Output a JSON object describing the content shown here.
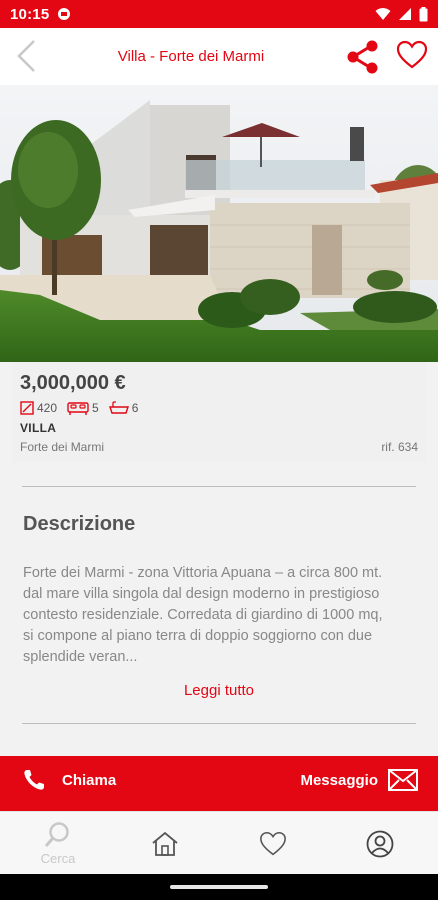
{
  "status_bar": {
    "time": "10:15"
  },
  "header": {
    "title": "Villa - Forte dei Marmi"
  },
  "listing": {
    "price": "3,000,000 €",
    "features": {
      "area": "420",
      "bedrooms": "5",
      "bathrooms": "6"
    },
    "type": "VILLA",
    "location": "Forte dei Marmi",
    "reference": "rif. 634"
  },
  "description": {
    "title": "Descrizione",
    "text": "Forte dei Marmi - zona Vittoria Apuana – a circa 800 mt. dal mare villa singola dal design moderno in prestigioso contesto residenziale. Corredata di giardino di 1000 mq, si compone al piano terra di doppio soggiorno con due splendide veran...",
    "read_more": "Leggi tutto"
  },
  "actions": {
    "call": "Chiama",
    "message": "Messaggio"
  },
  "bottom_nav": {
    "search": "Cerca"
  },
  "colors": {
    "accent": "#e30613",
    "text_muted": "#888888"
  },
  "icons": [
    "back-icon",
    "share-icon",
    "heart-icon",
    "phone-icon",
    "mail-icon",
    "search-icon",
    "home-icon",
    "user-icon"
  ]
}
